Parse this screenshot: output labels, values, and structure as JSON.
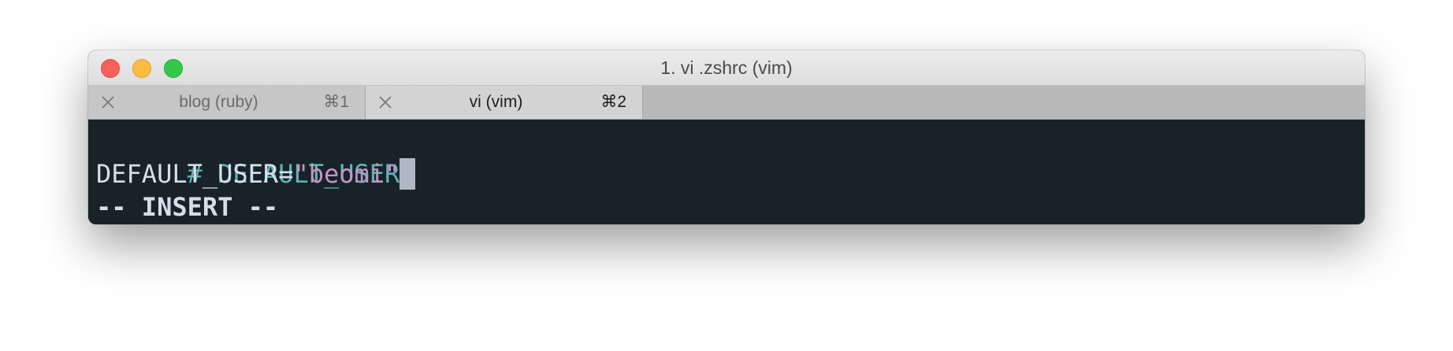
{
  "window": {
    "title": "1. vi .zshrc (vim)"
  },
  "tabs": [
    {
      "label": "blog (ruby)",
      "shortcut": "⌘1",
      "active": false
    },
    {
      "label": "vi (vim)",
      "shortcut": "⌘2",
      "active": true
    }
  ],
  "editor": {
    "comment_line": "# DEFAULT_USER",
    "var_name": "DEFAULT_USER=",
    "string_value": "\"beomi\"",
    "mode_indicator": "-- INSERT --"
  },
  "colors": {
    "terminal_bg": "#182229",
    "comment": "#5fb3b3",
    "string": "#c594c5",
    "text": "#d8dee9",
    "cursor": "#aeb8c5"
  },
  "icons": {
    "tab_close": "close-icon"
  }
}
